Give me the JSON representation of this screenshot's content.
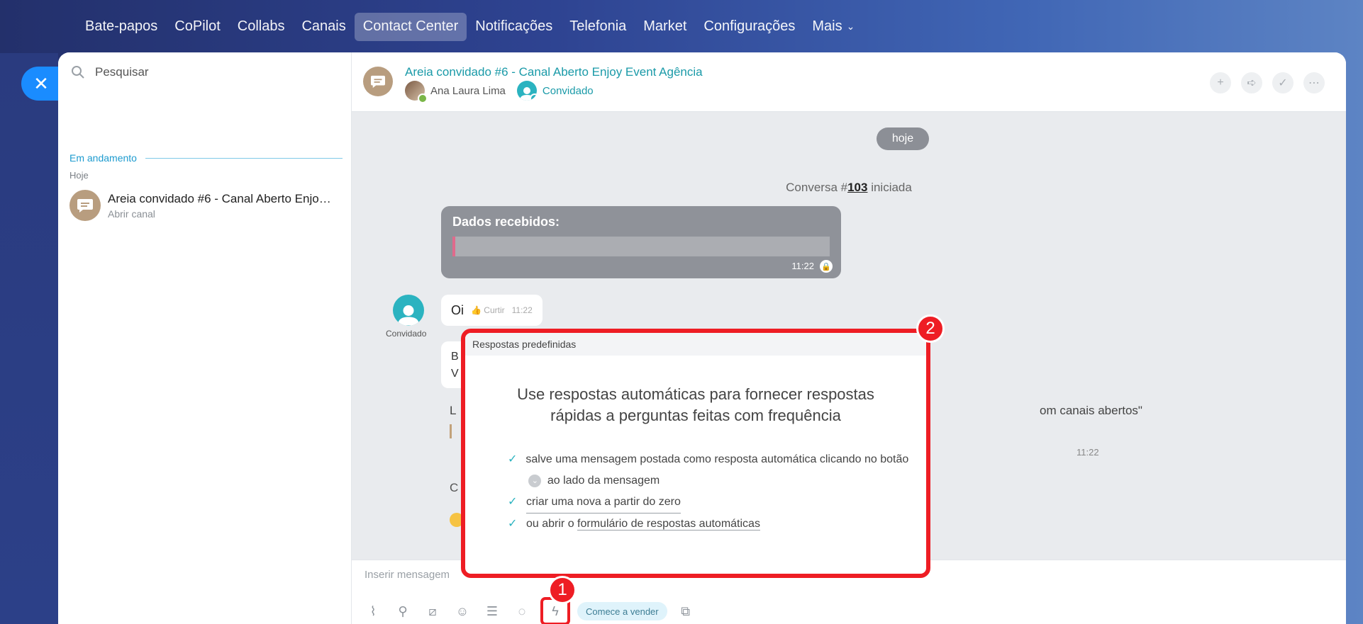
{
  "nav": {
    "items": [
      "Bate-papos",
      "CoPilot",
      "Collabs",
      "Canais",
      "Contact Center",
      "Notificações",
      "Telefonia",
      "Market",
      "Configurações",
      "Mais"
    ],
    "active": "Contact Center",
    "more_icon": "chevron-down-icon"
  },
  "sidebar": {
    "search_placeholder": "Pesquisar",
    "section_title": "Em andamento",
    "today": "Hoje",
    "chat": {
      "title": "Areia convidado #6 - Canal Aberto Enjoy Event Agência",
      "subtitle": "Abrir canal"
    }
  },
  "header": {
    "title": "Areia convidado #6 - Canal Aberto Enjoy Event Agência",
    "member1": "Ana Laura Lima",
    "member2": "Convidado"
  },
  "messages": {
    "date": "hoje",
    "system_prefix": "Conversa #",
    "system_number": "103",
    "system_suffix": " iniciada",
    "data_title": "Dados recebidos:",
    "data_time": "11:22",
    "guest_label": "Convidado",
    "oi": "Oi",
    "like": "Curtir",
    "oi_time": "11:22",
    "partial_line1": "B",
    "partial_line2": "V",
    "partial_l": "L",
    "partial_right": "om canais abertos\"",
    "partial_time": "11:22",
    "partial_c": "C"
  },
  "composer": {
    "placeholder": "Inserir mensagem",
    "sell_label": "Comece a vender"
  },
  "popup": {
    "header": "Respostas predefinidas",
    "heading": "Use respostas automáticas para fornecer respostas rápidas a perguntas feitas com frequência",
    "item1_a": "salve uma mensagem postada como resposta automática clicando no botão",
    "item1_b": "ao lado da mensagem",
    "item2": "criar uma nova a partir do zero",
    "item3_prefix": "ou abrir o ",
    "item3_link": "formulário de respostas automáticas"
  },
  "annotations": {
    "badge1": "1",
    "badge2": "2"
  },
  "colors": {
    "accent_red": "#ee1d24",
    "teal": "#1a9aa8",
    "blue": "#1a8cff"
  }
}
